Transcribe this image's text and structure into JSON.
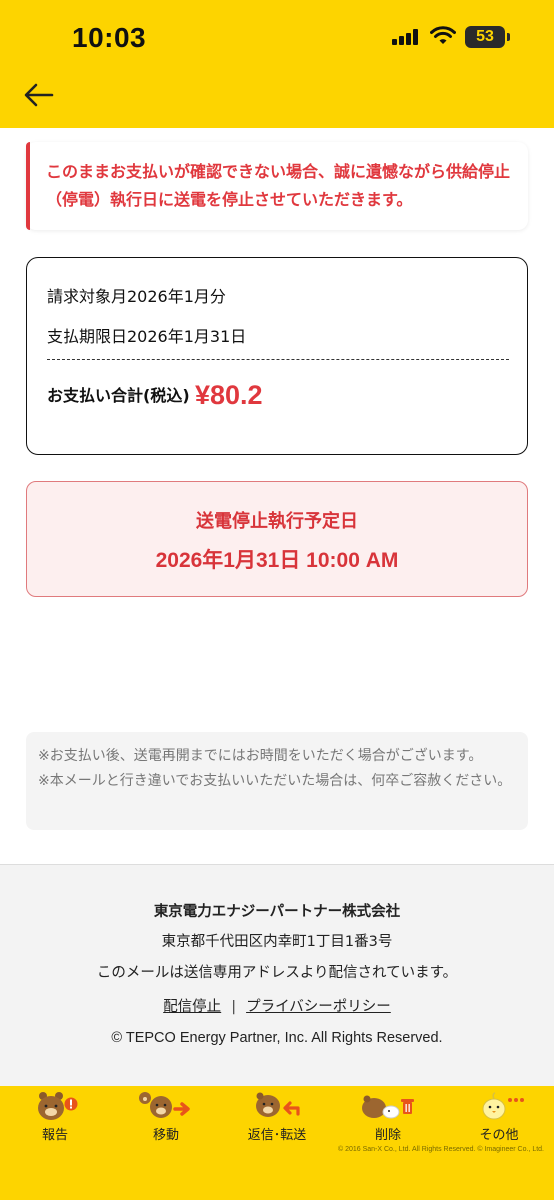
{
  "status_bar": {
    "time": "10:03",
    "battery_level": "53"
  },
  "header": {
    "back_icon": "arrow-left-icon",
    "accent_color": "#FDD400"
  },
  "alert": {
    "message": "このままお支払いが確認できない場合、誠に遺憾ながら供給停止（停電）執行日に送電を停止させていただきます。",
    "color": "#E0383E"
  },
  "bill": {
    "billing_month": "請求対象月2026年1月分",
    "due_date": "支払期限日2026年1月31日",
    "total_label": "お支払い合計(税込)",
    "total_amount": "¥80.2"
  },
  "stop_notice": {
    "title": "送電停止執行予定日",
    "date": "2026年1月31日 10:00 AM"
  },
  "notes": [
    "※お支払い後、送電再開までにはお時間をいただく場合がございます。",
    "※本メールと行き違いでお支払いいただいた場合は、何卒ご容赦ください。"
  ],
  "footer": {
    "company": "東京電力エナジーパートナー株式会社",
    "address": "東京都千代田区内幸町1丁目1番3号",
    "message": "このメールは送信専用アドレスより配信されています。",
    "unsubscribe": "配信停止",
    "separator": "|",
    "privacy": "プライバシーポリシー",
    "copyright": "© TEPCO Energy Partner, Inc. All Rights Reserved."
  },
  "tabbar": {
    "items": [
      {
        "label": "報告",
        "icon": "bear-report-icon"
      },
      {
        "label": "移動",
        "icon": "bear-move-icon"
      },
      {
        "label": "返信･転送",
        "icon": "bear-reply-icon"
      },
      {
        "label": "削除",
        "icon": "bear-delete-icon"
      },
      {
        "label": "その他",
        "icon": "chick-more-icon"
      }
    ],
    "credit": "© 2016 San-X Co., Ltd. All Rights Reserved.  © Imagineer Co., Ltd."
  }
}
